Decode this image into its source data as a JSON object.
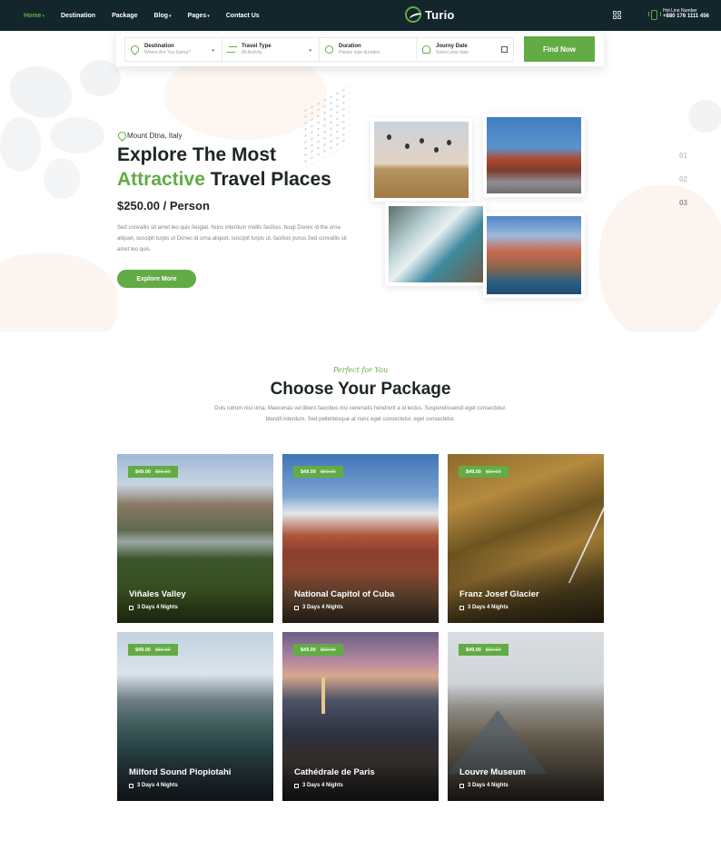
{
  "nav": {
    "links": [
      {
        "label": "Home",
        "caret": "▾"
      },
      {
        "label": "Destination",
        "caret": ""
      },
      {
        "label": "Package",
        "caret": ""
      },
      {
        "label": "Blog",
        "caret": "▾"
      },
      {
        "label": "Pages",
        "caret": "▾"
      },
      {
        "label": "Contact Us",
        "caret": ""
      }
    ],
    "brand": "Turio",
    "hotline_label": "Hot Line Number",
    "hotline_number": "+880 176 1111 456"
  },
  "search": {
    "fields": [
      {
        "label": "Destination",
        "placeholder": "Where Are You Going?"
      },
      {
        "label": "Travel Type",
        "placeholder": "All Activity"
      },
      {
        "label": "Duration",
        "placeholder": "Please type duration"
      },
      {
        "label": "Journy Date",
        "placeholder": "Select your date"
      }
    ],
    "button": "Find Now"
  },
  "hero": {
    "location": "Mount Dtna, Italy",
    "title_line1": "Explore The Most",
    "title_green": "Attractive",
    "title_rest": " Travel Places",
    "price": "$250.00 / Person",
    "description": "Sed convallis sit amet leo quis feugiat. Nunc interdum mollis facilisis. feugi Donec id the urna aliquet, suscipit turpis ut Donec id urna aliquet, suscipit turpis ut, facilisis purus.Sed convallis sit amet leo quis.",
    "button": "Explore More",
    "slides": [
      "01",
      "02",
      "03"
    ],
    "active_slide": "03"
  },
  "packages": {
    "eyebrow": "Perfect for You",
    "title": "Choose Your Package",
    "description": "Duis rutrum nisl urna. Maecenas vel libero faucibus nisi venenatis hendrerit a id lectus. Suspendissendt eget consectetur. blandit interdum. Sed pellentesque at nunc eget consectetur. eget consectetur.",
    "items": [
      {
        "title": "Viñales Valley",
        "duration": "3 Days 4 Nights",
        "price": "$49.00",
        "old_price": "$59.00"
      },
      {
        "title": "National Capitol of Cuba",
        "duration": "3 Days 4 Nights",
        "price": "$49.00",
        "old_price": "$59.00"
      },
      {
        "title": "Franz Josef Glacier",
        "duration": "3 Days 4 Nights",
        "price": "$49.00",
        "old_price": "$59.00"
      },
      {
        "title": "Milford Sound Piopiotahi",
        "duration": "3 Days 4 Nights",
        "price": "$49.00",
        "old_price": "$59.00"
      },
      {
        "title": "Cathédrale de Paris",
        "duration": "3 Days 4 Nights",
        "price": "$49.00",
        "old_price": "$59.00"
      },
      {
        "title": "Louvre Museum",
        "duration": "3 Days 4 Nights",
        "price": "$49.00",
        "old_price": "$59.00"
      }
    ]
  },
  "colors": {
    "accent": "#63ab45",
    "nav_bg": "#12262b",
    "heading": "#1d2527"
  },
  "icons": [
    "grid-icon",
    "phone-icon",
    "pin-icon",
    "calendar-icon",
    "clock-icon",
    "cloud-upload-icon",
    "plane-icon"
  ]
}
